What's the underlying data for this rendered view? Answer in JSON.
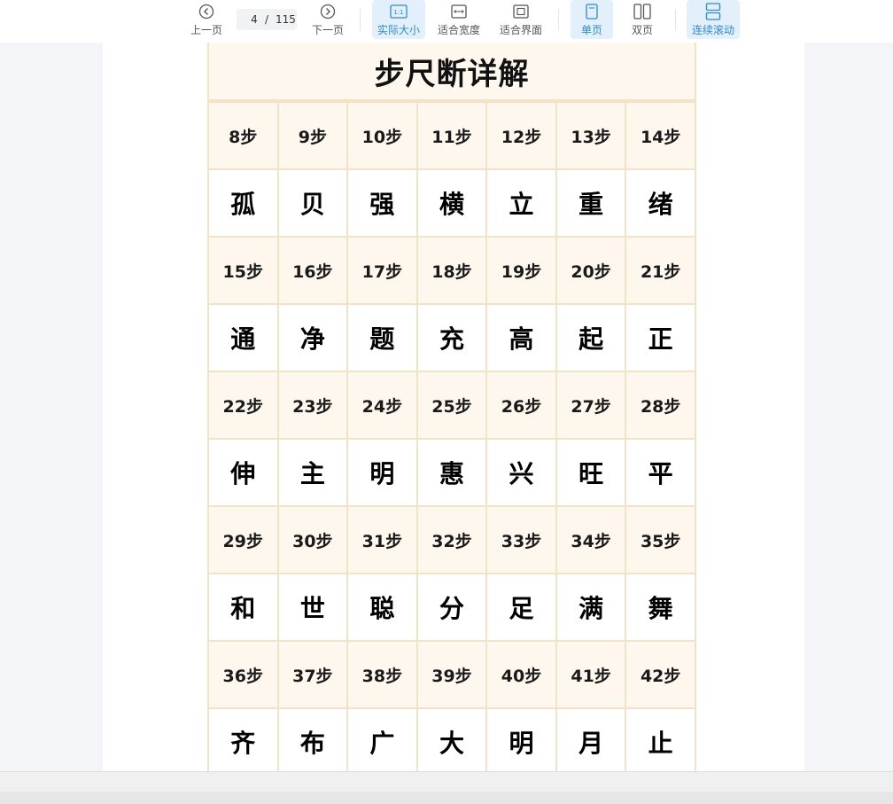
{
  "toolbar": {
    "prev_label": "上一页",
    "next_label": "下一页",
    "page_current": "4",
    "page_sep": "/",
    "page_total": "115",
    "actual_size_icon_text": "1:1",
    "actual_size_label": "实际大小",
    "fit_width_label": "适合宽度",
    "fit_page_label": "适合界面",
    "single_page_label": "单页",
    "double_page_label": "双页",
    "continuous_label": "连续滚动",
    "accent_color": "#2b8ad8"
  },
  "document": {
    "title": "步尺断详解",
    "rows": [
      {
        "steps": [
          "8步",
          "9步",
          "10步",
          "11步",
          "12步",
          "13步",
          "14步"
        ],
        "chars": [
          "孤",
          "贝",
          "强",
          "横",
          "立",
          "重",
          "绪"
        ]
      },
      {
        "steps": [
          "15步",
          "16步",
          "17步",
          "18步",
          "19步",
          "20步",
          "21步"
        ],
        "chars": [
          "通",
          "净",
          "题",
          "充",
          "高",
          "起",
          "正"
        ]
      },
      {
        "steps": [
          "22步",
          "23步",
          "24步",
          "25步",
          "26步",
          "27步",
          "28步"
        ],
        "chars": [
          "伸",
          "主",
          "明",
          "惠",
          "兴",
          "旺",
          "平"
        ]
      },
      {
        "steps": [
          "29步",
          "30步",
          "31步",
          "32步",
          "33步",
          "34步",
          "35步"
        ],
        "chars": [
          "和",
          "世",
          "聪",
          "分",
          "足",
          "满",
          "舞"
        ]
      },
      {
        "steps": [
          "36步",
          "37步",
          "38步",
          "39步",
          "40步",
          "41步",
          "42步"
        ],
        "chars": [
          "齐",
          "布",
          "广",
          "大",
          "明",
          "月",
          "止"
        ]
      }
    ]
  }
}
